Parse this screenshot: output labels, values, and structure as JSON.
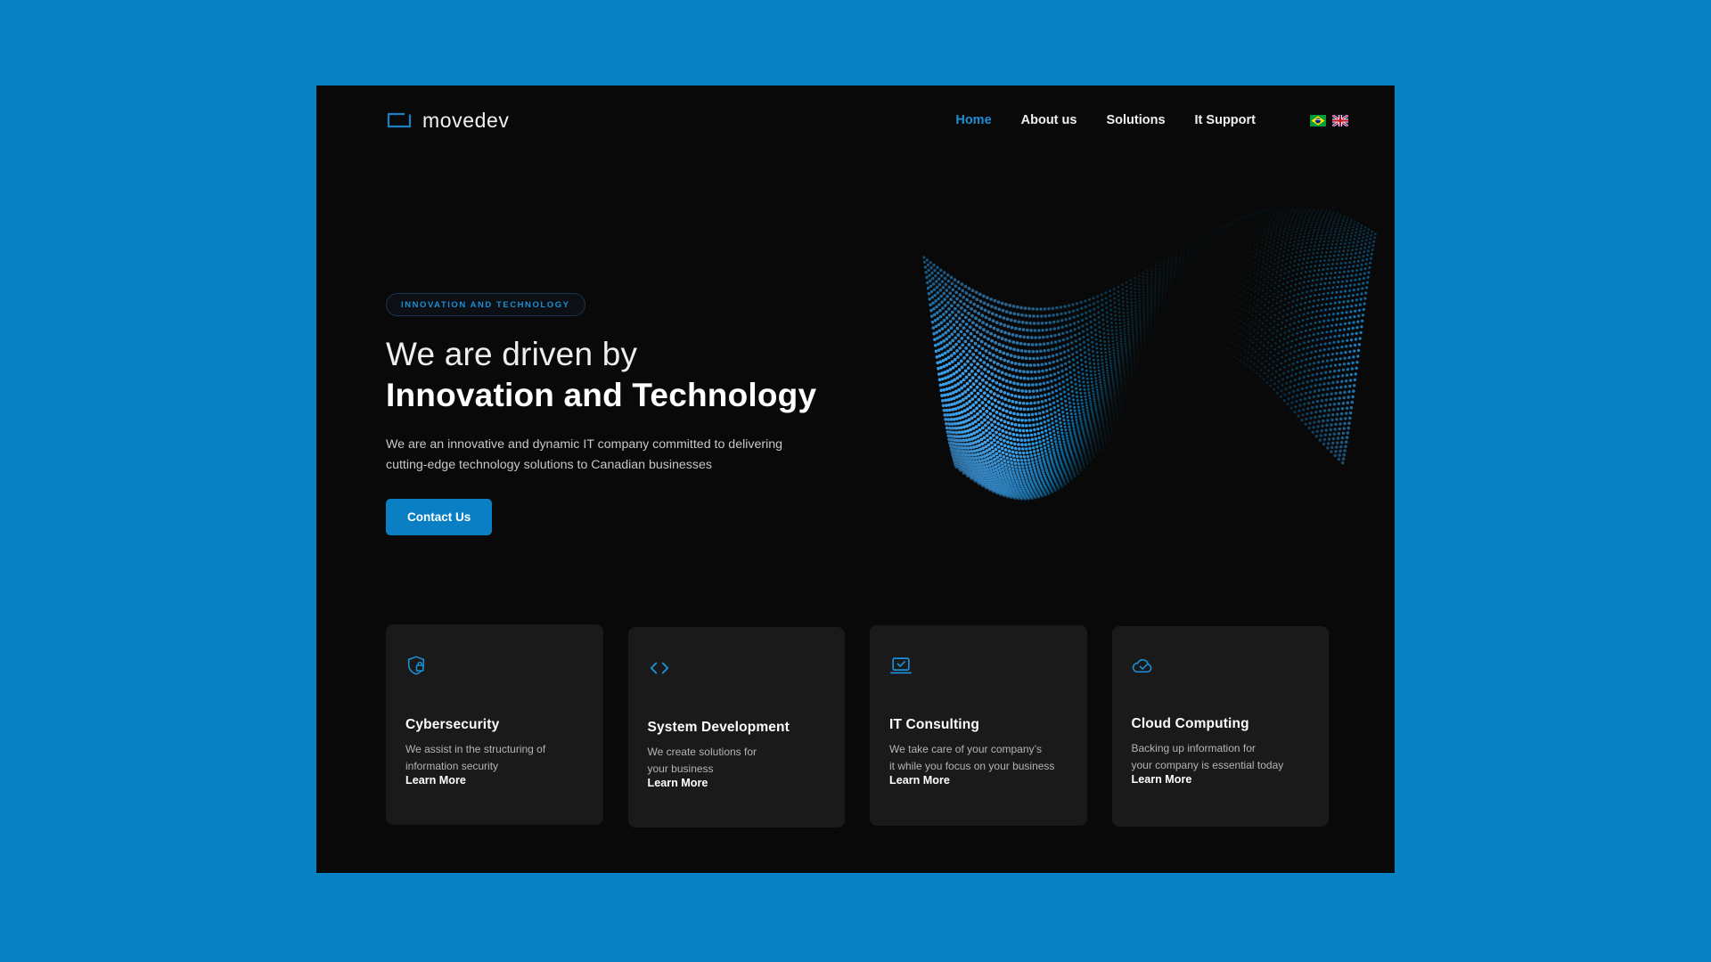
{
  "theme": {
    "page_background": "#0880c4",
    "surface": "#090909",
    "card_surface": "#1a1a1a",
    "accent": "#0a7fc4",
    "accent_text": "#1b8fd6",
    "text_primary": "#ffffff",
    "text_muted": "#b4b4b4"
  },
  "header": {
    "logo_text": "movedev",
    "logo_icon": "rounded-rectangle-outline-icon",
    "nav": [
      {
        "label": "Home",
        "active": true
      },
      {
        "label": "About us",
        "active": false
      },
      {
        "label": "Solutions",
        "active": false
      },
      {
        "label": "It Support",
        "active": false
      }
    ],
    "languages": [
      {
        "name": "brazil-flag-icon",
        "label": "Português (Brasil)"
      },
      {
        "name": "uk-flag-icon",
        "label": "English (UK)"
      }
    ]
  },
  "hero": {
    "badge": "INNOVATION AND TECHNOLOGY",
    "headline_line1": "We are driven by",
    "headline_line2": "Innovation and Technology",
    "description": "We are an innovative and dynamic IT company committed to delivering cutting-edge technology solutions to Canadian businesses",
    "cta_label": "Contact Us",
    "artwork": "abstract-blue-particle-wave"
  },
  "cards": [
    {
      "icon": "shield-lock-icon",
      "title": "Cybersecurity",
      "description": "We assist in the structuring of\ninformation security",
      "link_label": "Learn More"
    },
    {
      "icon": "code-brackets-icon",
      "title": "System Development",
      "description": "We create solutions for\nyour business",
      "link_label": "Learn More"
    },
    {
      "icon": "laptop-check-icon",
      "title": "IT Consulting",
      "description": "We take care of your company’s\nit while you focus on your business",
      "link_label": "Learn More"
    },
    {
      "icon": "cloud-check-icon",
      "title": "Cloud Computing",
      "description": "Backing up information for\nyour company is essential today",
      "link_label": "Learn More"
    }
  ]
}
